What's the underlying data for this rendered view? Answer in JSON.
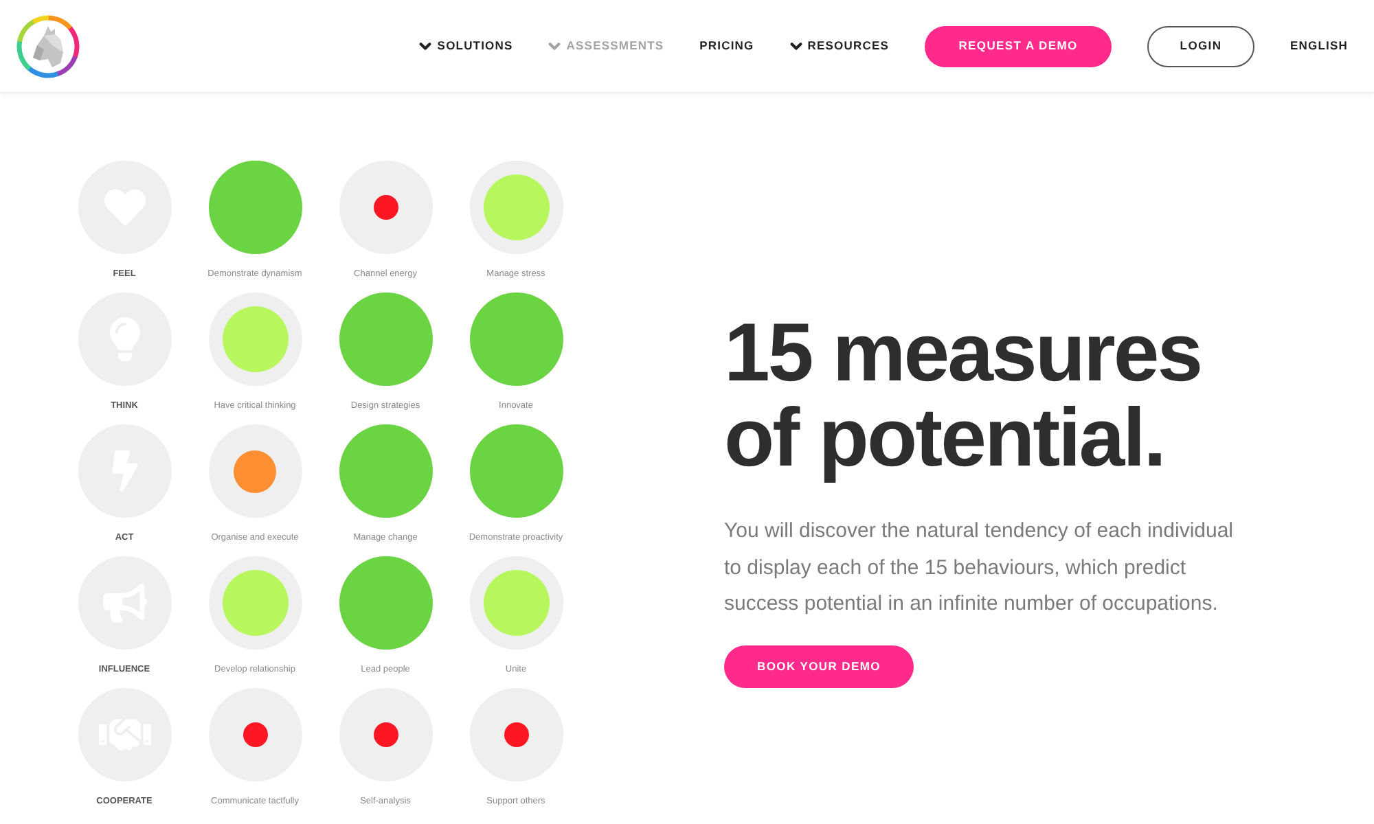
{
  "header": {
    "nav": [
      {
        "label": "SOLUTIONS",
        "dropdown": true,
        "selected": false
      },
      {
        "label": "ASSESSMENTS",
        "dropdown": true,
        "selected": true
      },
      {
        "label": "PRICING",
        "dropdown": false,
        "selected": false
      },
      {
        "label": "RESOURCES",
        "dropdown": true,
        "selected": false
      }
    ],
    "buttons": [
      {
        "label": "REQUEST A DEMO",
        "kind": "primary"
      },
      {
        "label": "LOGIN",
        "kind": "outline"
      }
    ],
    "language": "ENGLISH"
  },
  "grid": {
    "rows": [
      {
        "category": "FEEL",
        "measures": [
          {
            "label": "Demonstrate dynamism",
            "kind": "full",
            "color": "#6ad443"
          },
          {
            "label": "Channel energy",
            "kind": "small",
            "color": "#fd1623"
          },
          {
            "label": "Manage stress",
            "kind": "large",
            "color": "#b8f65e"
          }
        ]
      },
      {
        "category": "THINK",
        "measures": [
          {
            "label": "Have critical thinking",
            "kind": "large",
            "color": "#b8f65e"
          },
          {
            "label": "Design strategies",
            "kind": "full",
            "color": "#6ad443"
          },
          {
            "label": "Innovate",
            "kind": "full",
            "color": "#6ad443"
          }
        ]
      },
      {
        "category": "ACT",
        "measures": [
          {
            "label": "Organise and execute",
            "kind": "medium",
            "color": "#fd8f32"
          },
          {
            "label": "Manage change",
            "kind": "full",
            "color": "#6ad443"
          },
          {
            "label": "Demonstrate proactivity",
            "kind": "full",
            "color": "#6ad443"
          }
        ]
      },
      {
        "category": "INFLUENCE",
        "measures": [
          {
            "label": "Develop relationship",
            "kind": "large",
            "color": "#b8f65e"
          },
          {
            "label": "Lead people",
            "kind": "full",
            "color": "#6ad443"
          },
          {
            "label": "Unite",
            "kind": "large",
            "color": "#b8f65e"
          }
        ]
      },
      {
        "category": "COOPERATE",
        "measures": [
          {
            "label": "Communicate tactfully",
            "kind": "small",
            "color": "#fd1623"
          },
          {
            "label": "Self-analysis",
            "kind": "small",
            "color": "#fd1623"
          },
          {
            "label": "Support others",
            "kind": "small",
            "color": "#fd1623"
          }
        ]
      }
    ]
  },
  "hero": {
    "title": "15 measures of potential.",
    "text": "You will discover the natural tendency of each individual to display each of the 15 behaviours, which predict success potential in an infinite number of occupations.",
    "button": "BOOK YOUR DEMO"
  }
}
